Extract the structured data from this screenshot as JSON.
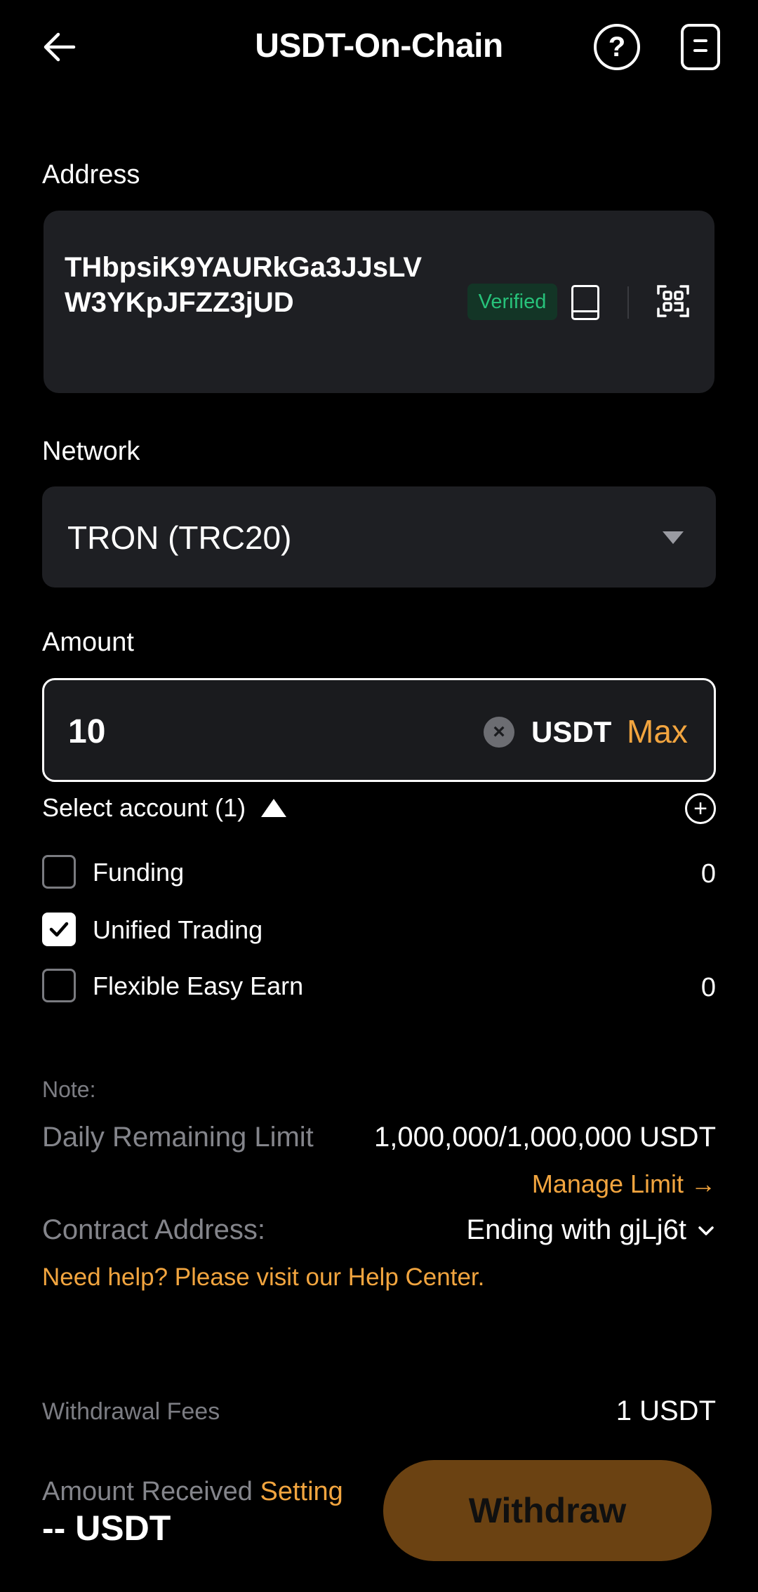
{
  "header": {
    "title": "USDT-On-Chain",
    "back_icon": "arrow-left-icon",
    "help_icon": "question-circle-icon",
    "help_glyph": "?",
    "records_icon": "document-icon"
  },
  "address": {
    "label": "Address",
    "line1": "THbpsiK9YAURkGa3JJsLV",
    "line2": "W3YKpJFZZ3jUD",
    "badge": "Verified",
    "address_book_icon": "address-book-icon",
    "scan_icon": "qr-scan-icon"
  },
  "network": {
    "label": "Network",
    "value": "TRON (TRC20)"
  },
  "amount": {
    "label": "Amount",
    "value": "10",
    "clear_glyph": "×",
    "currency": "USDT",
    "max_label": "Max"
  },
  "accounts": {
    "select_label": "Select account (1)",
    "add_glyph": "+",
    "items": [
      {
        "label": "Funding",
        "value": "0",
        "checked": false
      },
      {
        "label": "Unified Trading",
        "value": "",
        "checked": true
      },
      {
        "label": "Flexible Easy Earn",
        "value": "0",
        "checked": false
      }
    ]
  },
  "notes": {
    "note_label": "Note:",
    "daily_limit_label": "Daily Remaining Limit",
    "daily_limit_value": "1,000,000/1,000,000 USDT",
    "manage_limit": "Manage Limit →",
    "contract_label": "Contract Address:",
    "contract_value": "Ending with gjLj6t",
    "help_text": "Need help? Please visit our Help Center."
  },
  "footer": {
    "fees_label": "Withdrawal Fees",
    "fees_value": "1 USDT",
    "received_label": "Amount Received",
    "setting_label": "Setting",
    "received_value": "-- USDT",
    "withdraw_label": "Withdraw"
  },
  "colors": {
    "background": "#000000",
    "surface": "#1e1f23",
    "accent": "#f2a53f",
    "verified": "#27c27a",
    "withdraw_button": "#6b4212"
  }
}
